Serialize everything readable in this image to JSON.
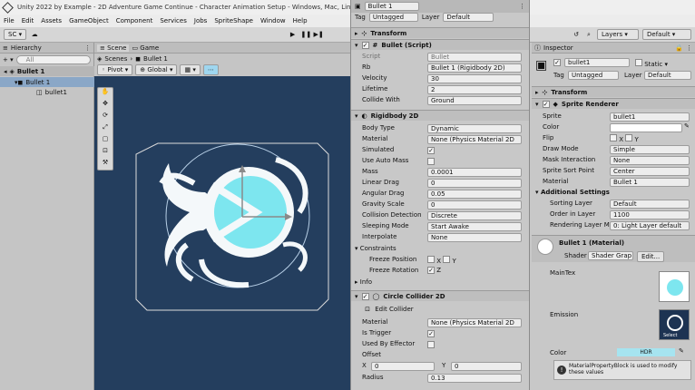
{
  "titlebar": {
    "text": "Unity 2022 by Example - 2D Adventure Game Continue - Character Animation Setup - Windows, Mac, Linux - Unity 2"
  },
  "menu": [
    "File",
    "Edit",
    "Assets",
    "GameObject",
    "Component",
    "Services",
    "Jobs",
    "SpriteShape",
    "Window",
    "Help"
  ],
  "toolbar": {
    "account": "SC",
    "layers": "Layers",
    "layout": "Default"
  },
  "hierarchy": {
    "tab": "Hierarchy",
    "search_placeholder": "All",
    "scene": "Bullet 1",
    "root": "Bullet 1",
    "child": "bullet1"
  },
  "scene": {
    "tab": "Scene",
    "game_tab": "Game",
    "crumb_scenes": "Scenes",
    "crumb_obj": "Bullet 1",
    "pivot": "Pivot",
    "global": "Global"
  },
  "insp1": {
    "name": "Bullet 1",
    "tag_label": "Tag",
    "tag": "Untagged",
    "layer_label": "Layer",
    "layer": "Default",
    "transform": "Transform",
    "script_comp": "Bullet (Script)",
    "script_label": "Script",
    "script_val": "Bullet",
    "rb_label": "Rb",
    "rb_val": "Bullet 1 (Rigidbody 2D)",
    "velocity_label": "Velocity",
    "velocity": "30",
    "lifetime_label": "Lifetime",
    "lifetime": "2",
    "collide_label": "Collide With",
    "collide": "Ground",
    "rb_comp": "Rigidbody 2D",
    "body_label": "Body Type",
    "body": "Dynamic",
    "mat_label": "Material",
    "mat": "None (Physics Material 2D",
    "sim_label": "Simulated",
    "auto_label": "Use Auto Mass",
    "mass_label": "Mass",
    "mass": "0.0001",
    "ldrag_label": "Linear Drag",
    "ldrag": "0",
    "adrag_label": "Angular Drag",
    "adrag": "0.05",
    "grav_label": "Gravity Scale",
    "grav": "0",
    "coll_label": "Collision Detection",
    "coll": "Discrete",
    "sleep_label": "Sleeping Mode",
    "sleep": "Start Awake",
    "interp_label": "Interpolate",
    "interp": "None",
    "constraints": "Constraints",
    "fpos_label": "Freeze Position",
    "frot_label": "Freeze Rotation",
    "x": "X",
    "y": "Y",
    "z": "Z",
    "info": "Info",
    "cc_comp": "Circle Collider 2D",
    "edit_collider": "Edit Collider",
    "cc_mat_label": "Material",
    "cc_mat": "None (Physics Material 2D",
    "trig_label": "Is Trigger",
    "eff_label": "Used By Effector",
    "offset_label": "Offset",
    "off_x": "0",
    "off_y": "0",
    "radius_label": "Radius",
    "radius": "0.13"
  },
  "insp2": {
    "tab": "Inspector",
    "name": "bullet1",
    "static": "Static",
    "tag_label": "Tag",
    "tag": "Untagged",
    "layer_label": "Layer",
    "layer": "Default",
    "transform": "Transform",
    "sr": "Sprite Renderer",
    "sprite_label": "Sprite",
    "sprite": "bullet1",
    "color_label": "Color",
    "flip_label": "Flip",
    "x": "X",
    "y": "Y",
    "draw_label": "Draw Mode",
    "draw": "Simple",
    "mask_label": "Mask Interaction",
    "mask": "None",
    "sort_label": "Sprite Sort Point",
    "sort": "Center",
    "mat_label": "Material",
    "mat": "Bullet 1",
    "add_settings": "Additional Settings",
    "slayer_label": "Sorting Layer",
    "slayer": "Default",
    "order_label": "Order in Layer",
    "order": "1100",
    "rlayer_label": "Rendering Layer M",
    "rlayer": "0: Light Layer default",
    "material_title": "Bullet 1 (Material)",
    "shader_label": "Shader",
    "shader": "Shader Grap",
    "edit": "Edit...",
    "maintex": "MainTex",
    "emission": "Emission",
    "color2": "Color",
    "hdr": "HDR",
    "select": "Select",
    "info": "MaterialPropertyBlock is used to modify these values"
  }
}
